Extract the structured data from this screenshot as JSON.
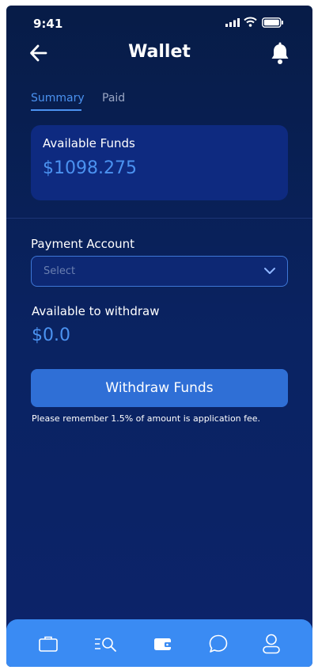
{
  "status_bar": {
    "time": "9:41"
  },
  "header": {
    "title": "Wallet",
    "back_icon": "arrow-left-icon",
    "notification_icon": "bell-icon"
  },
  "tabs": [
    {
      "label": "Summary",
      "active": true
    },
    {
      "label": "Paid",
      "active": false
    }
  ],
  "funds_card": {
    "label": "Available Funds",
    "amount": "$1098.275"
  },
  "payment_account": {
    "label": "Payment Account",
    "placeholder": "Select"
  },
  "withdraw": {
    "label": "Available to withdraw",
    "amount": "$0.0",
    "button_label": "Withdraw Funds",
    "note": "Please remember 1.5% of amount is application fee."
  },
  "bottom_nav": {
    "items": [
      {
        "icon": "briefcase-icon"
      },
      {
        "icon": "search-list-icon"
      },
      {
        "icon": "wallet-icon",
        "active": true
      },
      {
        "icon": "chat-icon"
      },
      {
        "icon": "profile-icon"
      }
    ]
  },
  "colors": {
    "accent": "#4b92f0",
    "button": "#2f6fd6",
    "nav_bg": "#3a8bf3",
    "card_bg": "#0e2a80"
  }
}
